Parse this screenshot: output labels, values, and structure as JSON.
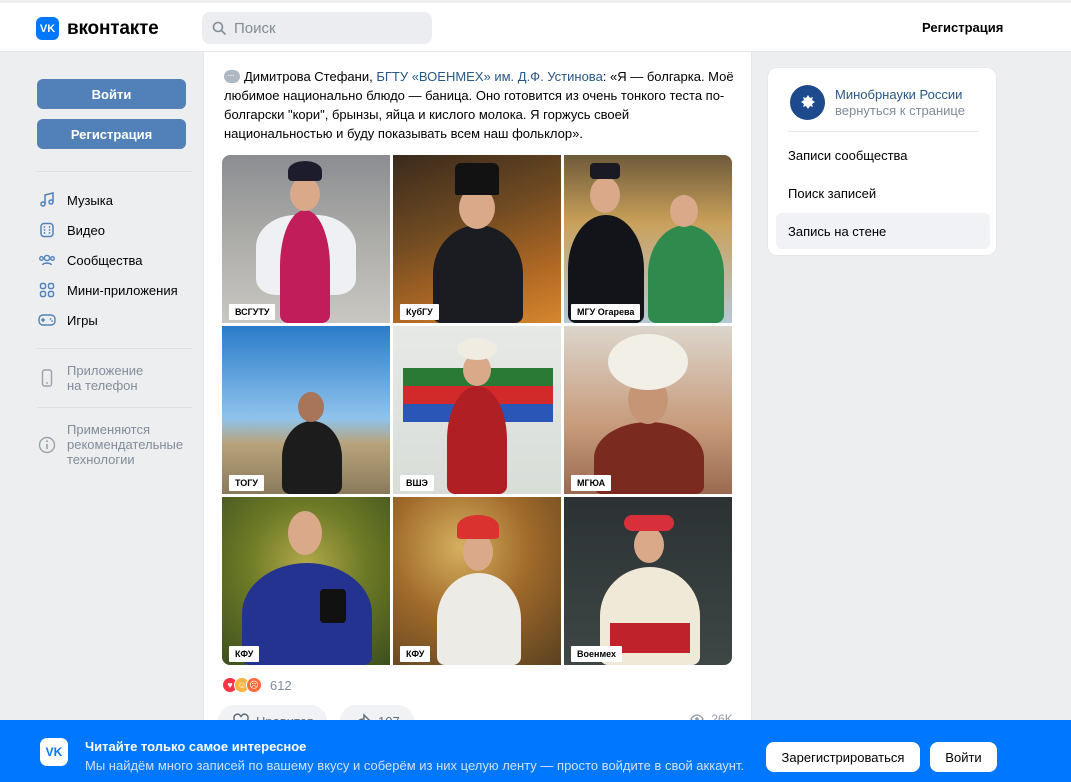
{
  "header": {
    "logo_mark": "VK",
    "logo_text": "вконтакте",
    "search_placeholder": "Поиск",
    "register_label": "Регистрация"
  },
  "sidebar": {
    "login_label": "Войти",
    "register_label": "Регистрация",
    "nav": [
      {
        "label": "Музыка",
        "icon": "music-icon"
      },
      {
        "label": "Видео",
        "icon": "video-icon"
      },
      {
        "label": "Сообщества",
        "icon": "communities-icon"
      },
      {
        "label": "Мини-приложения",
        "icon": "apps-icon"
      },
      {
        "label": "Игры",
        "icon": "games-icon"
      }
    ],
    "app_line1": "Приложение",
    "app_line2": "на телефон",
    "rec_line1": "Применяются",
    "rec_line2": "рекомендательные",
    "rec_line3": "технологии"
  },
  "post": {
    "author": "Димитрова Стефани, ",
    "university": "БГТУ «ВОЕНМЕХ» им. Д.Ф. Устинова",
    "text": ": «Я — болгарка. Моё любимое национально блюдо — баница. Оно готовится из очень тонкого теста по-болгарски \"кори\", брынзы, яйца и кислого молока. Я горжусь своей национальностью и буду показывать всем наш фольклор».",
    "photos": [
      {
        "caption": "ВСГУТУ"
      },
      {
        "caption": "КубГУ"
      },
      {
        "caption": "МГУ Огарева"
      },
      {
        "caption": "ТОГУ"
      },
      {
        "caption": "ВШЭ"
      },
      {
        "caption": "МГЮА"
      },
      {
        "caption": "КФУ"
      },
      {
        "caption": "КФУ"
      },
      {
        "caption": "Военмех"
      }
    ],
    "reactions_count": "612",
    "like_label": "Нравится",
    "share_count": "107",
    "views": "26K"
  },
  "right_panel": {
    "org_name": "Минобрнауки России",
    "org_back": "вернуться к странице",
    "links": [
      "Записи сообщества",
      "Поиск записей",
      "Запись на стене"
    ]
  },
  "banner": {
    "logo_mark": "VK",
    "title": "Читайте только самое интересное",
    "subtitle": "Мы найдём много записей по вашему вкусу и соберём из них целую ленту — просто войдите в свой аккаунт.",
    "register_label": "Зарегистрироваться",
    "login_label": "Войти"
  },
  "colors": {
    "brand": "#0077ff",
    "button": "#5181b8",
    "link": "#2a5885",
    "page_bg": "#edeef0"
  }
}
